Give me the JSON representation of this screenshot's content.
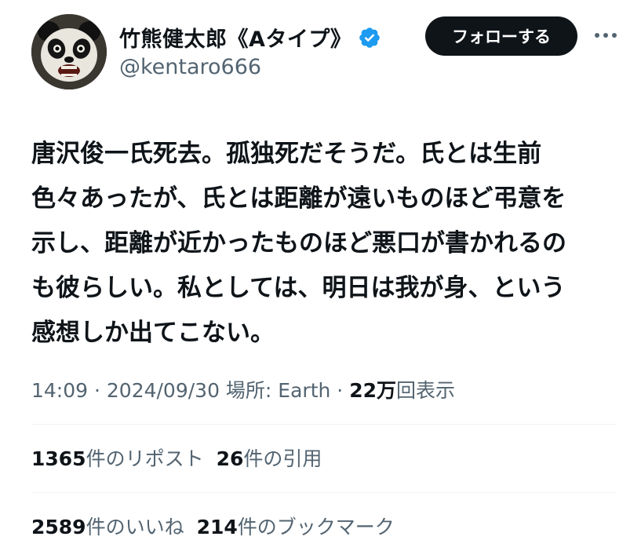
{
  "user": {
    "display_name": "竹熊健太郎《Aタイプ》",
    "handle": "@kentaro666",
    "verified_color": "#1d9bf0"
  },
  "follow_button": {
    "label": "フォローする"
  },
  "tweet": {
    "lines": [
      "唐沢俊一氏死去。孤独死だそうだ。氏とは生前",
      "色々あったが、氏とは距離が遠いものほど弔意を",
      "示し、距離が近かったものほど悪口が書かれるの",
      "も彼らしい。私としては、明日は我が身、という",
      "感想しか出てこない。"
    ]
  },
  "meta": {
    "time": "14:09",
    "sep1": " · ",
    "date": "2024/09/30",
    "location": " 場所: Earth",
    "sep2": " · ",
    "views_count": "22万",
    "views_label": "回表示"
  },
  "stats": {
    "reposts_count": "1365",
    "reposts_label": "件のリポスト",
    "quotes_count": "26",
    "quotes_label": "件の引用",
    "likes_count": "2589",
    "likes_label": "件のいいね",
    "bookmarks_count": "214",
    "bookmarks_label": "件のブックマーク"
  },
  "icons": {
    "avatar": "panda-avatar",
    "verified": "verified-badge-icon",
    "more": "more-icon"
  }
}
